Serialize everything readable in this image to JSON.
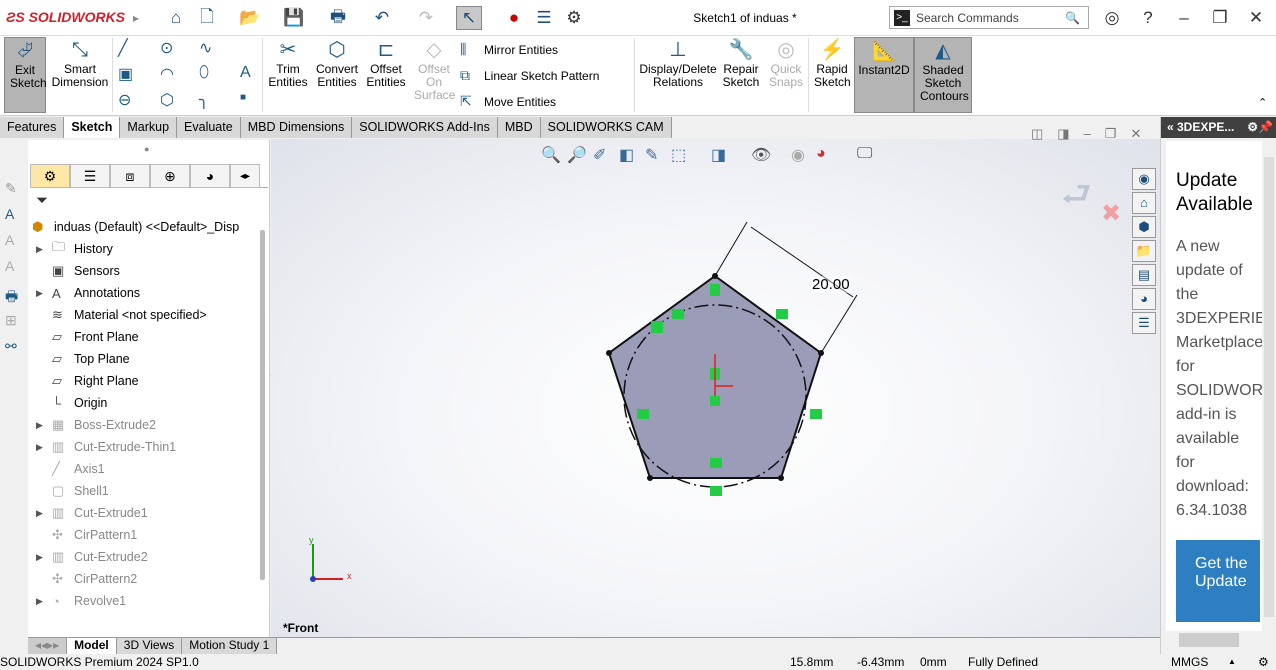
{
  "app": {
    "logo": "SOLIDWORKS",
    "title": "Sketch1 of induas *",
    "search_placeholder": "Search Commands"
  },
  "ribbon": {
    "exit_sketch": "Exit Sketch",
    "smart_dimension": "Smart Dimension",
    "trim": "Trim Entities",
    "convert": "Convert Entities",
    "offset": "Offset Entities",
    "offset_surface": "Offset On Surface",
    "mirror": "Mirror Entities",
    "linear_pattern": "Linear Sketch Pattern",
    "move": "Move Entities",
    "display_delete": "Display/Delete Relations",
    "repair": "Repair Sketch",
    "quick_snaps": "Quick Snaps",
    "rapid": "Rapid Sketch",
    "instant2d": "Instant2D",
    "shaded": "Shaded Sketch Contours"
  },
  "tabs": [
    "Features",
    "Sketch",
    "Markup",
    "Evaluate",
    "MBD Dimensions",
    "SOLIDWORKS Add-Ins",
    "MBD",
    "SOLIDWORKS CAM"
  ],
  "active_tab": "Sketch",
  "tree": {
    "root": "induas (Default) <<Default>_Disp",
    "items": [
      {
        "label": "History",
        "arrow": true,
        "grey": false,
        "icon": "folder-icon"
      },
      {
        "label": "Sensors",
        "arrow": false,
        "grey": false,
        "icon": "sensor-icon"
      },
      {
        "label": "Annotations",
        "arrow": true,
        "grey": false,
        "icon": "annotation-icon"
      },
      {
        "label": "Material <not specified>",
        "arrow": false,
        "grey": false,
        "icon": "material-icon"
      },
      {
        "label": "Front Plane",
        "arrow": false,
        "grey": false,
        "icon": "plane-icon"
      },
      {
        "label": "Top Plane",
        "arrow": false,
        "grey": false,
        "icon": "plane-icon"
      },
      {
        "label": "Right Plane",
        "arrow": false,
        "grey": false,
        "icon": "plane-icon"
      },
      {
        "label": "Origin",
        "arrow": false,
        "grey": false,
        "icon": "origin-icon"
      },
      {
        "label": "Boss-Extrude2",
        "arrow": true,
        "grey": true,
        "icon": "extrude-icon"
      },
      {
        "label": "Cut-Extrude-Thin1",
        "arrow": true,
        "grey": true,
        "icon": "cut-icon"
      },
      {
        "label": "Axis1",
        "arrow": false,
        "grey": true,
        "icon": "axis-icon"
      },
      {
        "label": "Shell1",
        "arrow": false,
        "grey": true,
        "icon": "shell-icon"
      },
      {
        "label": "Cut-Extrude1",
        "arrow": true,
        "grey": true,
        "icon": "cut-icon"
      },
      {
        "label": "CirPattern1",
        "arrow": false,
        "grey": true,
        "icon": "pattern-icon"
      },
      {
        "label": "Cut-Extrude2",
        "arrow": true,
        "grey": true,
        "icon": "cut-icon"
      },
      {
        "label": "CirPattern2",
        "arrow": false,
        "grey": true,
        "icon": "pattern-icon"
      },
      {
        "label": "Revolve1",
        "arrow": true,
        "grey": true,
        "icon": "revolve-icon"
      }
    ]
  },
  "viewport": {
    "dimension": "20.00",
    "view_label": "*Front",
    "axis_x": "x",
    "axis_y": "y"
  },
  "right_panel": {
    "header": "« 3DEXPE...",
    "title": "Update Available",
    "body": [
      "A new",
      "update of",
      "the",
      "3DEXPERIE",
      "Marketplace",
      "for",
      "SOLIDWOR",
      "add-in is",
      "available",
      "for",
      "download:",
      "6.34.1038"
    ],
    "button": "Get the Update"
  },
  "bottom_tabs": [
    "Model",
    "3D Views",
    "Motion Study 1"
  ],
  "status": {
    "product": "SOLIDWORKS Premium 2024 SP1.0",
    "x": "15.8mm",
    "y": "-6.43mm",
    "z": "0mm",
    "state": "Fully Defined",
    "units": "MMGS"
  },
  "colors": {
    "accent": "#2e7fc2",
    "logo": "#d0202a",
    "sketch_fill": "#9a9cb8",
    "relation": "#22cc44"
  }
}
